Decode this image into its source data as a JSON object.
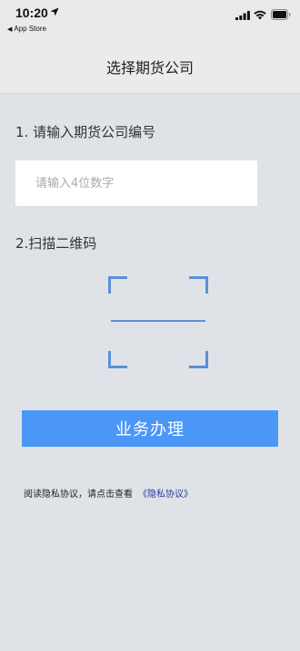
{
  "status_bar": {
    "time": "10:20",
    "back_app": "App Store",
    "icons": [
      "location-arrow-icon",
      "signal-icon",
      "wifi-icon",
      "battery-icon"
    ]
  },
  "nav": {
    "title": "选择期货公司"
  },
  "step1": {
    "label": "1. 请输入期货公司编号",
    "input_value": "",
    "input_placeholder": "请输入4位数字"
  },
  "step2": {
    "label": "2.扫描二维码",
    "scan_icon": "qr-scan-frame-icon"
  },
  "action": {
    "button_label": "业务办理"
  },
  "privacy": {
    "text": "阅读隐私协议，请点击查看",
    "link": "《隐私协议》"
  },
  "colors": {
    "background": "#dfe3e7",
    "accent": "#4a97f7",
    "scan_frame": "#5b8fd8",
    "link": "#2a3a9c"
  }
}
